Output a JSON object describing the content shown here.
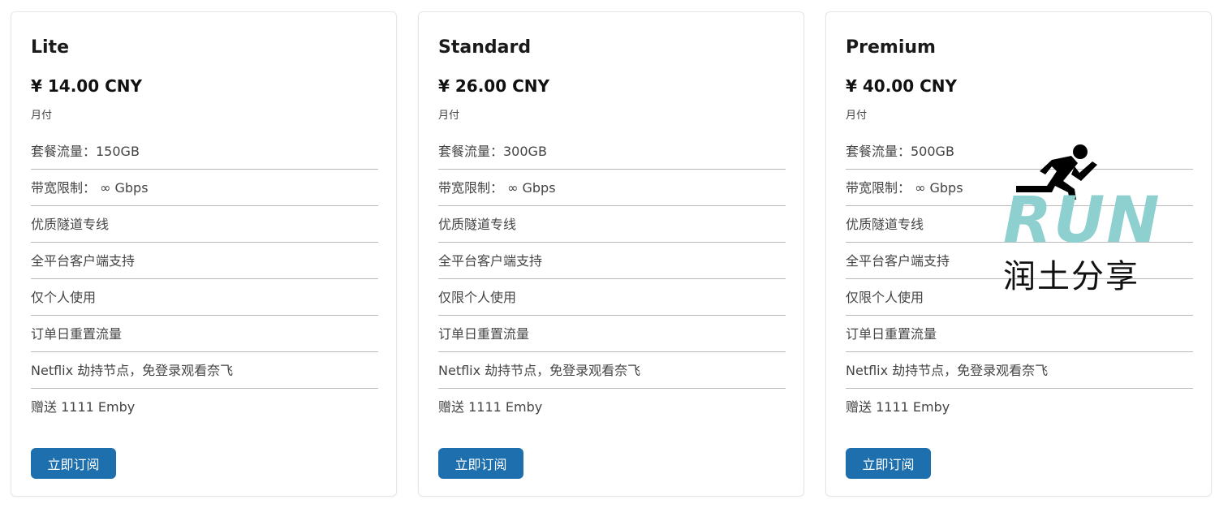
{
  "plans": [
    {
      "name": "Lite",
      "price": "¥ 14.00 CNY",
      "period": "月付",
      "features": [
        "套餐流量：150GB",
        "带宽限制： ∞ Gbps",
        "优质隧道专线",
        "全平台客户端支持",
        "仅个人使用",
        "订单日重置流量",
        "Netflix 劫持节点，免登录观看奈飞",
        "赠送 1111 Emby"
      ],
      "button_label": "立即订阅"
    },
    {
      "name": "Standard",
      "price": "¥ 26.00 CNY",
      "period": "月付",
      "features": [
        "套餐流量：300GB",
        "带宽限制： ∞ Gbps",
        "优质隧道专线",
        "全平台客户端支持",
        "仅限个人使用",
        "订单日重置流量",
        "Netflix 劫持节点，免登录观看奈飞",
        "赠送 1111 Emby"
      ],
      "button_label": "立即订阅"
    },
    {
      "name": "Premium",
      "price": "¥ 40.00 CNY",
      "period": "月付",
      "features": [
        "套餐流量：500GB",
        "带宽限制： ∞ Gbps",
        "优质隧道专线",
        "全平台客户端支持",
        "仅限个人使用",
        "订单日重置流量",
        "Netflix 劫持节点，免登录观看奈飞",
        "赠送 1111 Emby"
      ],
      "button_label": "立即订阅"
    }
  ],
  "watermark": {
    "logo_text": "RUN",
    "sub_text": "润土分享",
    "icon": "runner-icon",
    "logo_color": "#8ecfcf"
  },
  "colors": {
    "button": "#1d6fae",
    "button_text": "#ffffff",
    "divider": "#b9b9b9",
    "card_border": "#e6e6e6"
  }
}
